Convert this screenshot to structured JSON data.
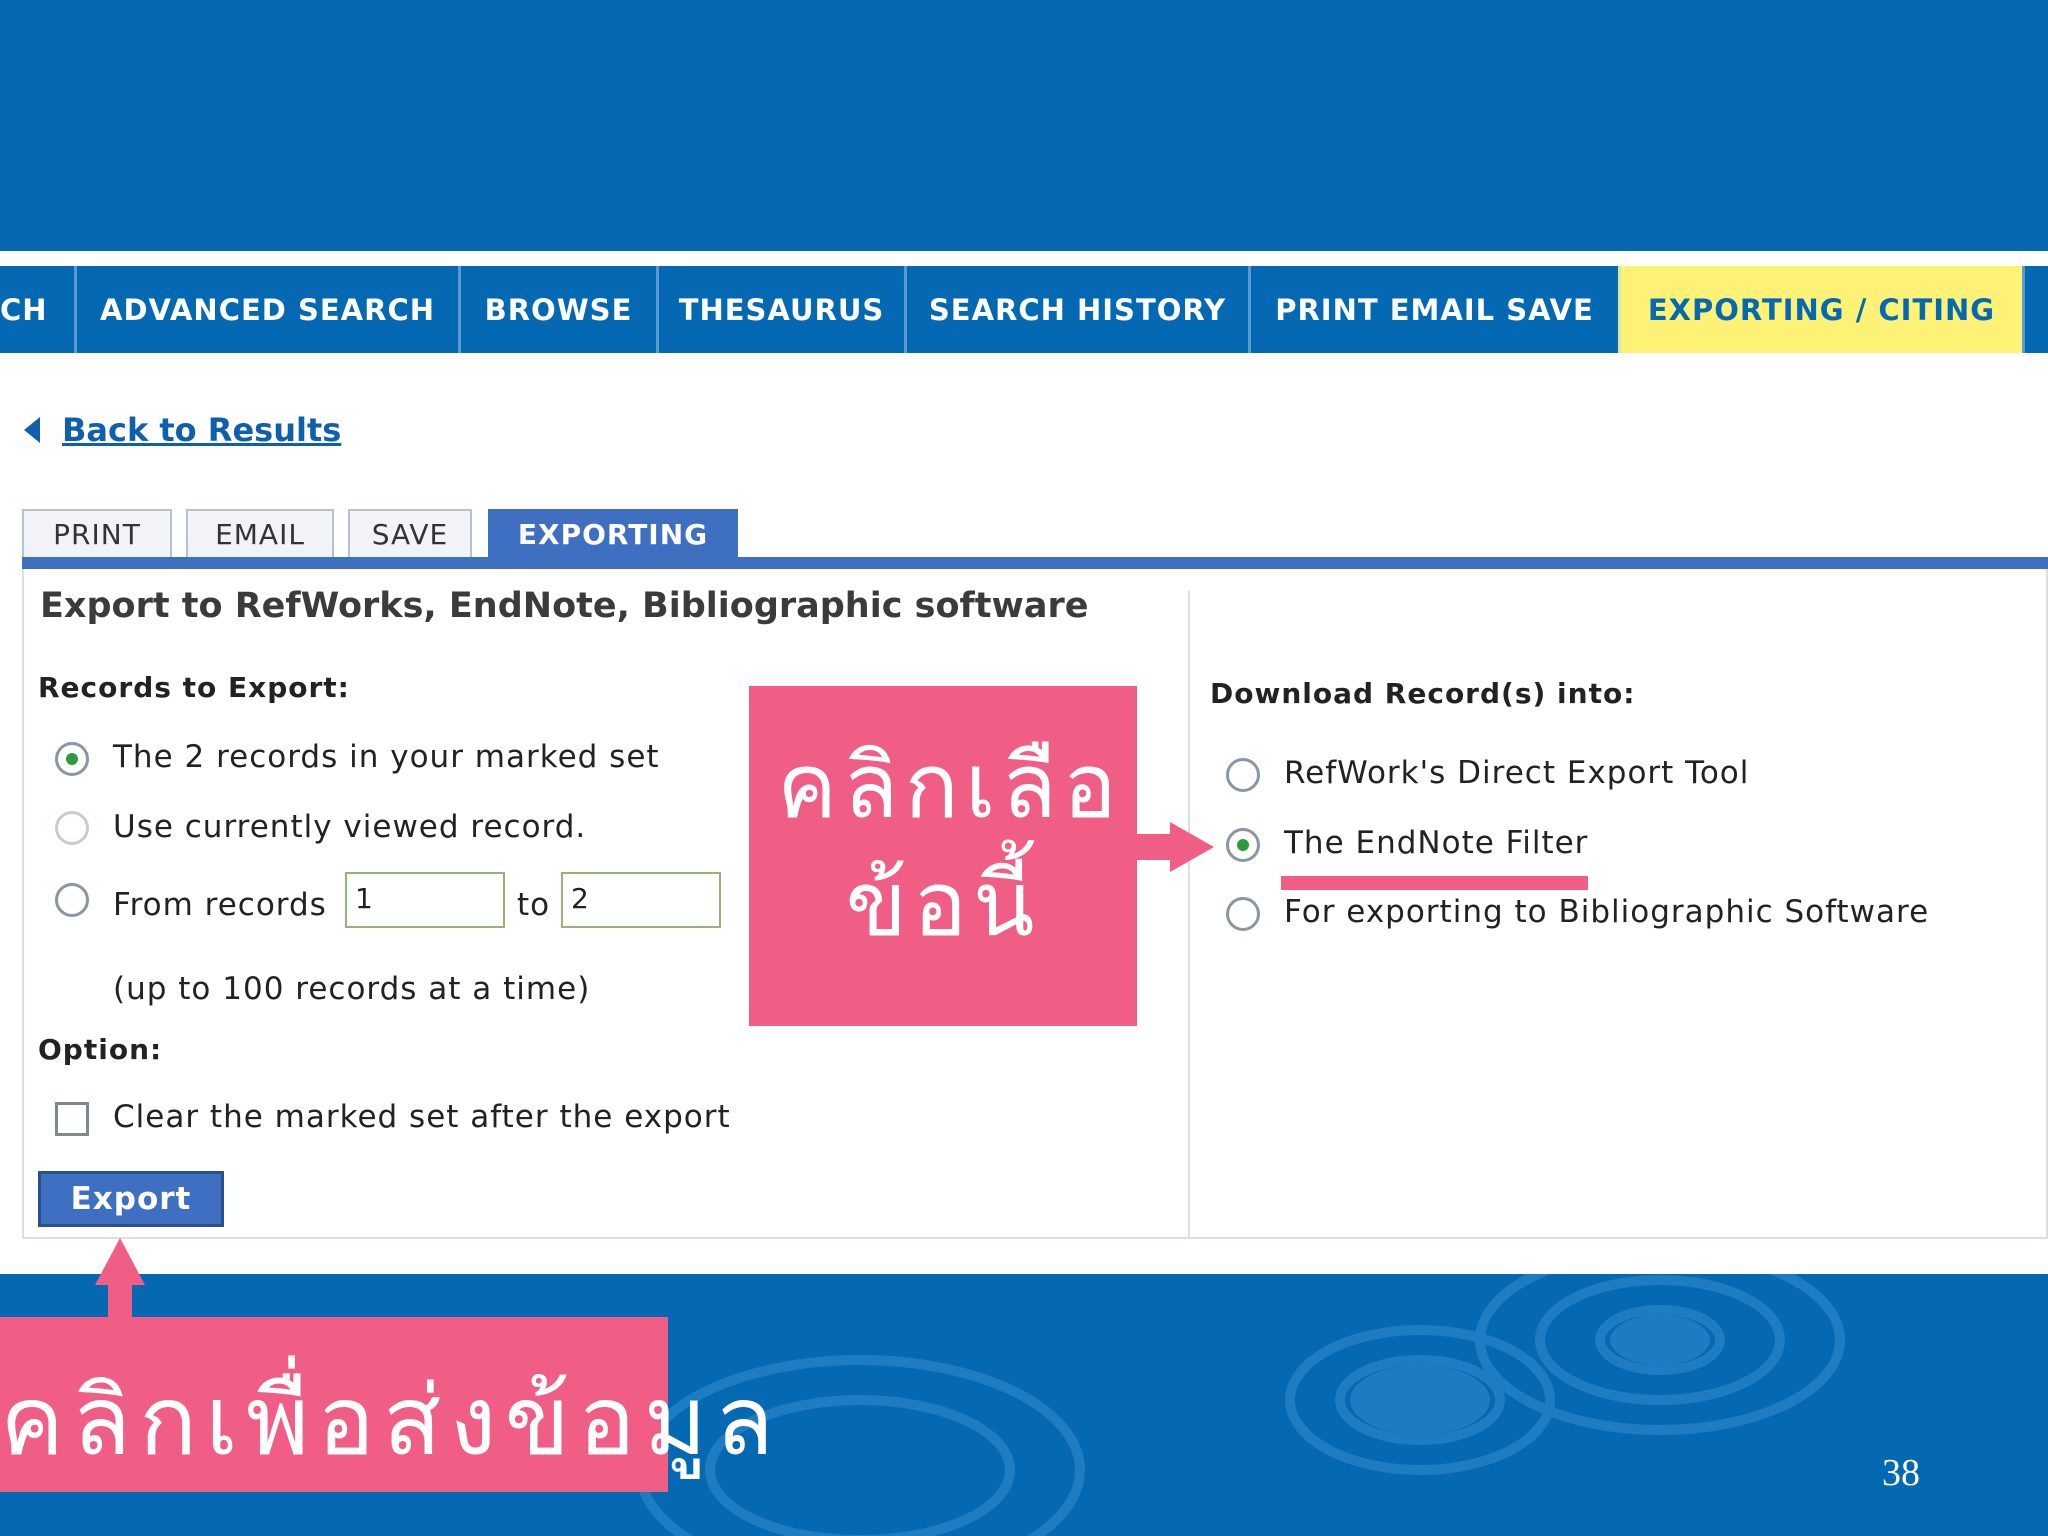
{
  "nav": {
    "tabs": [
      {
        "label": "CH"
      },
      {
        "label": "ADVANCED SEARCH"
      },
      {
        "label": "BROWSE"
      },
      {
        "label": "THESAURUS"
      },
      {
        "label": "SEARCH HISTORY"
      },
      {
        "label": "PRINT EMAIL SAVE"
      },
      {
        "label": "EXPORTING / CITING"
      }
    ],
    "active_tab": "EXPORTING / CITING"
  },
  "back_link": {
    "label": "Back to Results"
  },
  "subtabs": {
    "items": [
      {
        "label": "PRINT"
      },
      {
        "label": "EMAIL"
      },
      {
        "label": "SAVE"
      },
      {
        "label": "EXPORTING"
      }
    ],
    "active": "EXPORTING"
  },
  "panel": {
    "title": "Export to RefWorks, EndNote, Bibliographic software",
    "records": {
      "heading": "Records to Export:",
      "options": [
        {
          "label": "The 2 records in your marked set",
          "checked": true
        },
        {
          "label": "Use currently viewed record.",
          "checked": false
        },
        {
          "label": "From records",
          "checked": false
        }
      ],
      "from_value": "1",
      "to_label": "to",
      "to_value": "2",
      "note": "(up to 100 records at a time)"
    },
    "option": {
      "heading": "Option:",
      "checkbox_label": "Clear the marked set after the export",
      "checked": false
    },
    "export_button": "Export",
    "download": {
      "heading": "Download Record(s) into:",
      "options": [
        {
          "label": "RefWork's Direct Export Tool",
          "checked": false
        },
        {
          "label": "The EndNote Filter",
          "checked": true
        },
        {
          "label": "For exporting to Bibliographic Software",
          "checked": false
        }
      ]
    }
  },
  "callouts": {
    "select_line1": "คลิกเลือ",
    "select_line2": "ข้อนี้",
    "send": "คลิกเพื่อส่งข้อมูล"
  },
  "page_number": "38",
  "colors": {
    "slide_blue": "#0468b2",
    "active_tab": "#fdf276",
    "subtab_blue": "#3f6fc1",
    "callout_pink": "#f15e85",
    "radio_green": "#2e9a3e"
  }
}
